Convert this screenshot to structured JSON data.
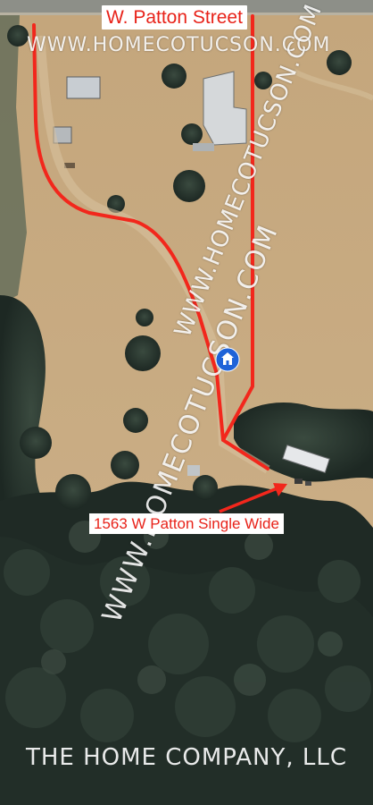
{
  "map": {
    "street_label": "W. Patton Street",
    "watermark_top": "WWW.HOMECOTUCSON.COM",
    "watermark_diagonal": "WWW.HOMECOTUCSON.COM",
    "home_label": "1563 W Patton Single Wide",
    "footer": "THE HOME COMPANY, LLC",
    "pin_icon": "home-icon",
    "colors": {
      "route": "#f2271c",
      "label_bg": "#ffffff",
      "label_text": "#e8231a",
      "pin": "#1f63d8",
      "dirt": "#c9ad84",
      "trees": "#26322c"
    }
  }
}
